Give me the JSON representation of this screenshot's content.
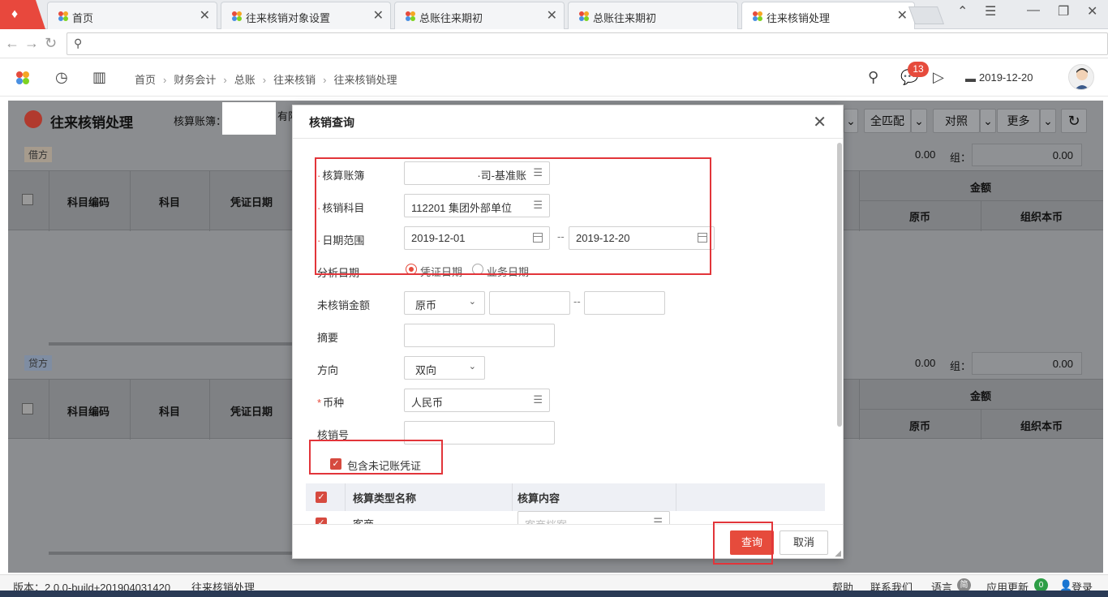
{
  "browser": {
    "tabs": [
      {
        "label": "首页"
      },
      {
        "label": "往来核销对象设置"
      },
      {
        "label": "总账往来期初"
      },
      {
        "label": "总账往来期初"
      },
      {
        "label": "往来核销处理"
      }
    ]
  },
  "header": {
    "breadcrumb": [
      "首页",
      "财务会计",
      "总账",
      "往来核销",
      "往来核销处理"
    ],
    "notification_count": "13",
    "date": "2019-12-20"
  },
  "page": {
    "title": "往来核销处理",
    "ledger_label": "核算账簿：",
    "ledger_suffix": "有限公",
    "buttons": [
      "全匹配",
      "对照",
      "更多"
    ],
    "debit_label": "借方",
    "credit_label": "贷方",
    "debit_total": "0.00",
    "debit_group_label": "组：",
    "debit_group_total": "0.00",
    "credit_total": "0.00",
    "credit_group_label": "组：",
    "credit_group_total": "0.00",
    "columns": [
      "科目编码",
      "科目",
      "凭证日期"
    ],
    "amount_header": "金额",
    "amount_sub": [
      "原币",
      "组织本币"
    ]
  },
  "dialog": {
    "title": "核销查询",
    "fields": {
      "ledger_label": "核算账簿",
      "ledger_value": "·司-基准账",
      "subject_label": "核销科目",
      "subject_value": "112201 集团外部单位",
      "date_range_label": "日期范围",
      "date_from": "2019-12-01",
      "date_to": "2019-12-20",
      "date_sep": "--",
      "analysis_date_label": "分析日期",
      "analysis_opt1": "凭证日期",
      "analysis_opt2": "业务日期",
      "unverified_amount_label": "未核销金额",
      "currency_type": "原币",
      "amount_sep": "--",
      "summary_label": "摘要",
      "direction_label": "方向",
      "direction_value": "双向",
      "currency_label": "币种",
      "currency_value": "人民币",
      "verify_no_label": "核销号",
      "include_unposted_label": "包含未记账凭证"
    },
    "table": {
      "col1": "核算类型名称",
      "col2": "核算内容",
      "row1_name": "客商",
      "row1_placeholder": "客商档案"
    },
    "query_button": "查询",
    "cancel_button": "取消"
  },
  "statusbar": {
    "version": "版本：2.0.0-build+201904031420",
    "page": "往来核销处理",
    "help": "帮助",
    "contact": "联系我们",
    "language": "语言",
    "language_badge": "简",
    "app_update": "应用更新",
    "update_count": "0",
    "login": "登录"
  }
}
